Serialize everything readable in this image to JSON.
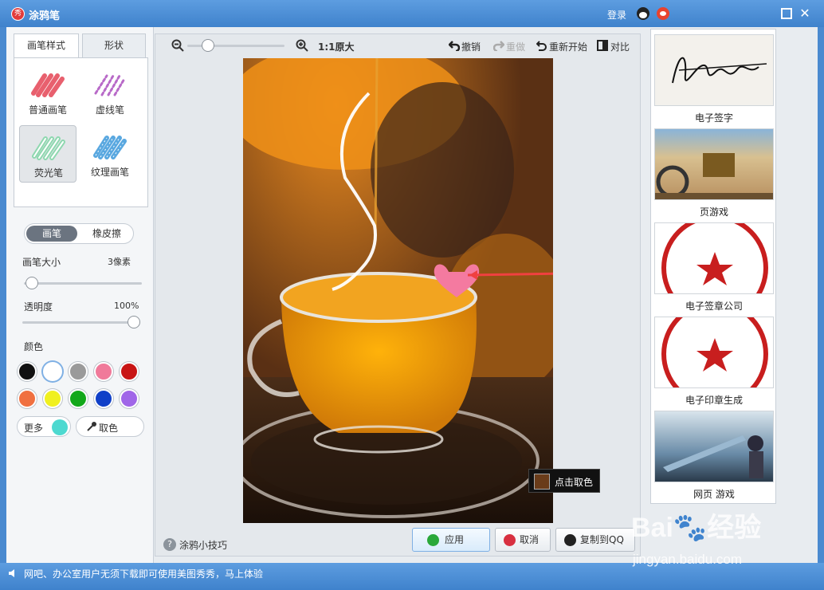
{
  "titlebar": {
    "title": "涂鸦笔",
    "logo_text": "秀",
    "login": "登录",
    "icons": [
      "qq-icon",
      "weibo-icon",
      "maximize-icon",
      "close-icon"
    ]
  },
  "left": {
    "tabs": [
      {
        "label": "画笔样式",
        "active": true
      },
      {
        "label": "形状",
        "active": false
      }
    ],
    "brushes": [
      {
        "label": "普通画笔",
        "color": "#e8606e",
        "selected": false
      },
      {
        "label": "虚线笔",
        "color": "#b86ac8",
        "selected": false
      },
      {
        "label": "荧光笔",
        "color": "#8fd8b0",
        "selected": true
      },
      {
        "label": "纹理画笔",
        "color": "#5aa8e0",
        "selected": false
      }
    ],
    "mode": {
      "on": "画笔",
      "off": "橡皮擦"
    },
    "size": {
      "label": "画笔大小",
      "value": "3像素",
      "level": 0.06
    },
    "opacity": {
      "label": "透明度",
      "value": "100%",
      "level": 1.0
    },
    "color_label": "颜色",
    "colors": [
      "#111111",
      "#ffffff",
      "#9a9a9a",
      "#f07a9a",
      "#c81414",
      "#f07040",
      "#f0f020",
      "#12a81a",
      "#1040c8",
      "#a066e8"
    ],
    "selected_color_index": 1,
    "more": {
      "label": "更多",
      "color": "#4dd9d0"
    },
    "picker": {
      "label": "取色"
    }
  },
  "toolbar": {
    "zoom_level": 0.16,
    "zoom_text": "1:1原大",
    "undo": "撤销",
    "redo": "重做",
    "restart": "重新开始",
    "compare": "对比"
  },
  "canvas": {
    "tooltip": "点击取色",
    "tooltip_color": "#6a3c1a"
  },
  "footer": {
    "tips": "涂鸦小技巧",
    "apply": "应用",
    "cancel": "取消",
    "copy_qq": "复制到QQ"
  },
  "ads": [
    {
      "label": "电子签字"
    },
    {
      "label": "页游戏"
    },
    {
      "label": "电子签章公司"
    },
    {
      "label": "电子印章生成"
    },
    {
      "label": "网页 游戏"
    }
  ],
  "status": {
    "text": "网吧、办公室用户无须下载即可使用美图秀秀，马上体验"
  },
  "watermark": {
    "main": "Bai",
    "main2": "经验",
    "sub": "jingyan.baidu.com"
  }
}
